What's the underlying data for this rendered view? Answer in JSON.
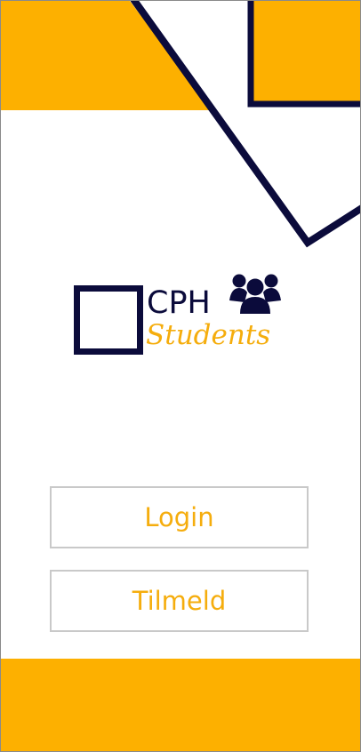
{
  "app": {
    "logo": {
      "title_line1": "CPH",
      "title_line2": "Students",
      "icon": "users-group-icon"
    }
  },
  "actions": {
    "login_label": "Login",
    "signup_label": "Tilmeld"
  },
  "colors": {
    "accent": "#FDB000",
    "navy": "#0B0B3B",
    "button_border": "#C9C9C9",
    "button_text": "#F5AD0D",
    "background": "#FFFFFF"
  }
}
